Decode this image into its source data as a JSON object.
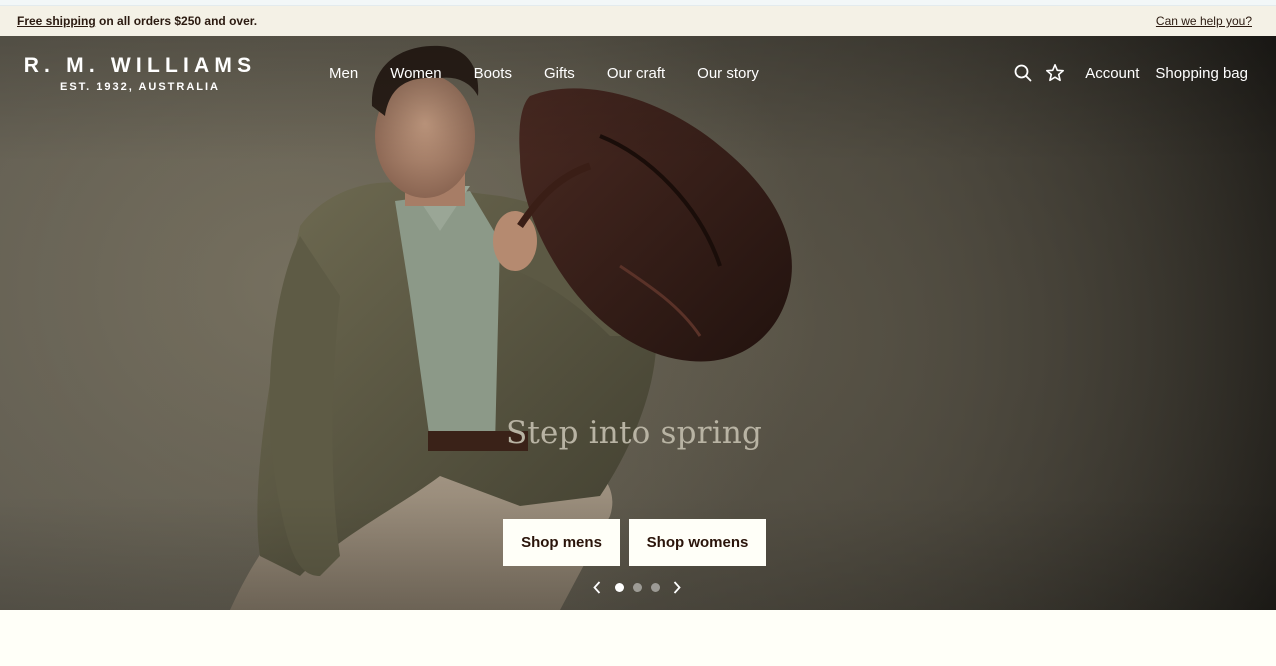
{
  "promo": {
    "link_text": "Free shipping",
    "rest_text": " on all orders $250 and over.",
    "help_text": "Can we help you?"
  },
  "brand": {
    "name": "R. M. WILLIAMS",
    "tagline": "EST. 1932, AUSTRALIA"
  },
  "nav": {
    "items": [
      {
        "label": "Men"
      },
      {
        "label": "Women"
      },
      {
        "label": "Boots"
      },
      {
        "label": "Gifts"
      },
      {
        "label": "Our craft"
      },
      {
        "label": "Our story"
      }
    ]
  },
  "utility": {
    "search_icon": "search-icon",
    "wishlist_icon": "star-icon",
    "account_label": "Account",
    "bag_label": "Shopping bag"
  },
  "hero": {
    "title": "Step into spring",
    "cta_mens": "Shop mens",
    "cta_womens": "Shop womens",
    "carousel": {
      "slide_count": 3,
      "active_index": 0
    }
  },
  "colors": {
    "promo_bg": "#f4f1e6",
    "page_bg": "#fffff8",
    "button_text": "#2a140a",
    "hero_title": "#b8b3a3"
  }
}
